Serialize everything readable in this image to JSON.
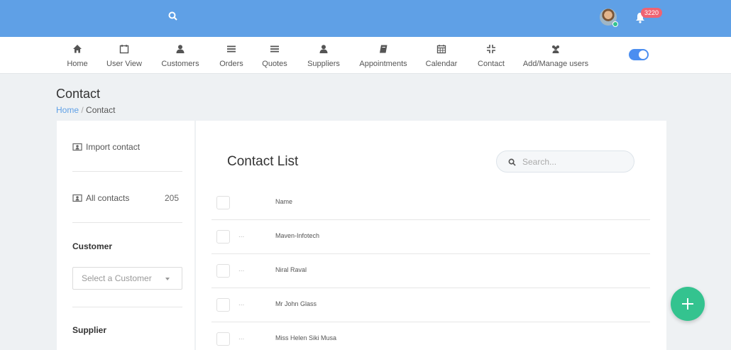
{
  "topbar": {
    "notification_count": "3220"
  },
  "nav": {
    "items": [
      {
        "label": "Home",
        "icon": "home-icon"
      },
      {
        "label": "User View",
        "icon": "calendar-outline-icon"
      },
      {
        "label": "Customers",
        "icon": "user-icon"
      },
      {
        "label": "Orders",
        "icon": "bars-icon"
      },
      {
        "label": "Quotes",
        "icon": "bars-icon"
      },
      {
        "label": "Suppliers",
        "icon": "user-icon"
      },
      {
        "label": "Appointments",
        "icon": "book-icon"
      },
      {
        "label": "Calendar",
        "icon": "calendar-icon"
      },
      {
        "label": "Contact",
        "icon": "compress-icon"
      },
      {
        "label": "Add/Manage users",
        "icon": "users-icon"
      }
    ],
    "toggle_on": true
  },
  "page": {
    "title": "Contact",
    "breadcrumb": {
      "home": "Home",
      "separator": "/",
      "current": "Contact"
    }
  },
  "sidebar": {
    "import_label": "Import contact",
    "all_contacts_label": "All contacts",
    "all_contacts_count": "205",
    "customer_heading": "Customer",
    "customer_select": "Select a Customer",
    "supplier_heading": "Supplier"
  },
  "list": {
    "title": "Contact List",
    "search_placeholder": "Search...",
    "column_name": "Name",
    "row_marker": "...",
    "rows": [
      {
        "name": "Maven-Infotech"
      },
      {
        "name": "Niral Raval"
      },
      {
        "name": "Mr John Glass"
      },
      {
        "name": "Miss Helen Siki Musa"
      }
    ]
  },
  "colors": {
    "topbar": "#5fa0e6",
    "accent": "#4b8ef0",
    "badge": "#f06371",
    "fab": "#34c38f"
  }
}
